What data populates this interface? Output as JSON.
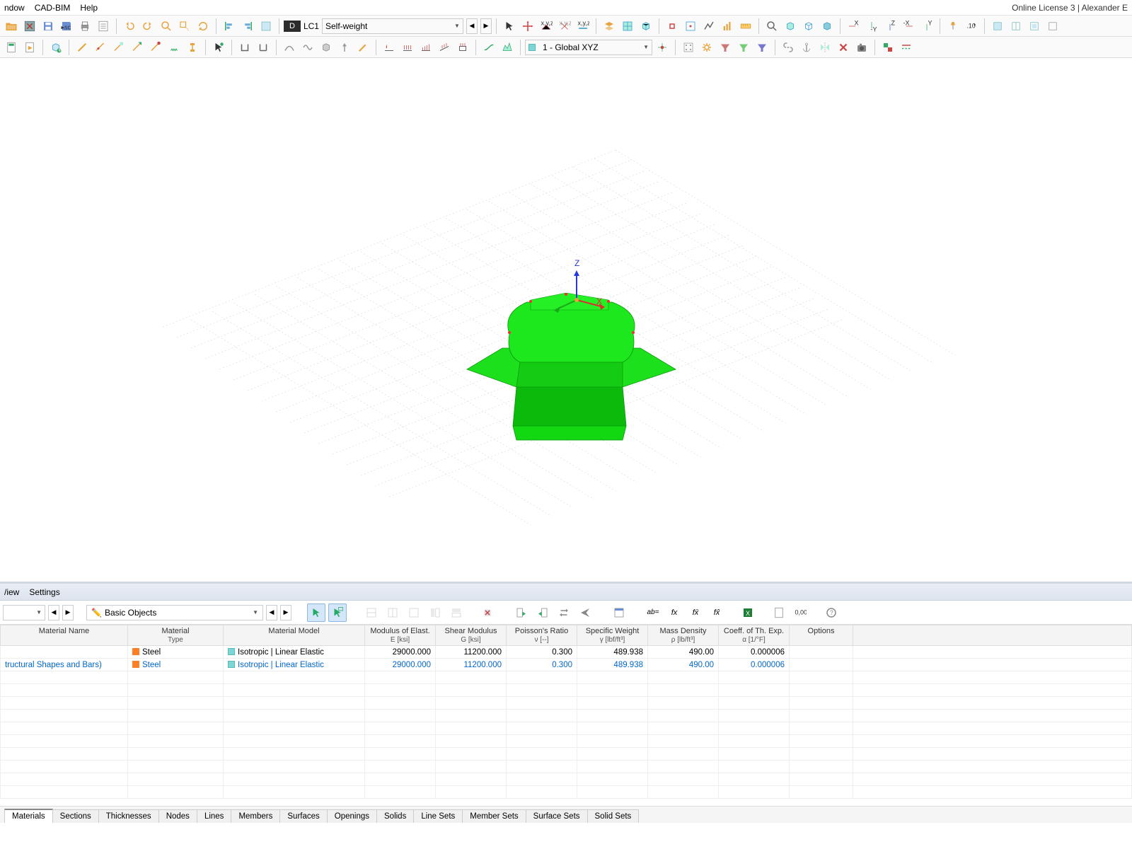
{
  "menu": {
    "items": [
      "ndow",
      "CAD-BIM",
      "Help"
    ],
    "license": "Online License 3 | Alexander E"
  },
  "toolbar1": {
    "lc_d": "D",
    "lc_code": "LC1",
    "lc_name": "Self-weight",
    "coord_swatch": "#7fd4d4",
    "coord": "1 - Global XYZ"
  },
  "lower": {
    "menu": [
      "/iew",
      "Settings"
    ],
    "basic_objects": "Basic Objects"
  },
  "icons_basic": "✏️",
  "fx_labels": [
    "ab=",
    "fx",
    "fx̄",
    "fx̂"
  ],
  "table": {
    "headers": [
      {
        "t": "Material Name",
        "s": ""
      },
      {
        "t": "Material",
        "s": "Type"
      },
      {
        "t": "Material Model",
        "s": ""
      },
      {
        "t": "Modulus of Elast.",
        "s": "E [ksi]"
      },
      {
        "t": "Shear Modulus",
        "s": "G [ksi]"
      },
      {
        "t": "Poisson's Ratio",
        "s": "ν [--]"
      },
      {
        "t": "Specific Weight",
        "s": "γ [lbf/ft³]"
      },
      {
        "t": "Mass Density",
        "s": "ρ [lb/ft³]"
      },
      {
        "t": "Coeff. of Th. Exp.",
        "s": "α [1/°F]"
      },
      {
        "t": "Options",
        "s": ""
      }
    ],
    "rows": [
      {
        "name": "",
        "type": "Steel",
        "model": "Isotropic | Linear Elastic",
        "e": "29000.000",
        "g": "11200.000",
        "v": "0.300",
        "sw": "489.938",
        "md": "490.00",
        "a": "0.000006",
        "blue": false
      },
      {
        "name": "tructural Shapes and Bars)",
        "type": "Steel",
        "model": "Isotropic | Linear Elastic",
        "e": "29000.000",
        "g": "11200.000",
        "v": "0.300",
        "sw": "489.938",
        "md": "490.00",
        "a": "0.000006",
        "blue": true
      }
    ]
  },
  "tabs": [
    "Materials",
    "Sections",
    "Thicknesses",
    "Nodes",
    "Lines",
    "Members",
    "Surfaces",
    "Openings",
    "Solids",
    "Line Sets",
    "Member Sets",
    "Surface Sets",
    "Solid Sets"
  ],
  "active_tab": 0
}
